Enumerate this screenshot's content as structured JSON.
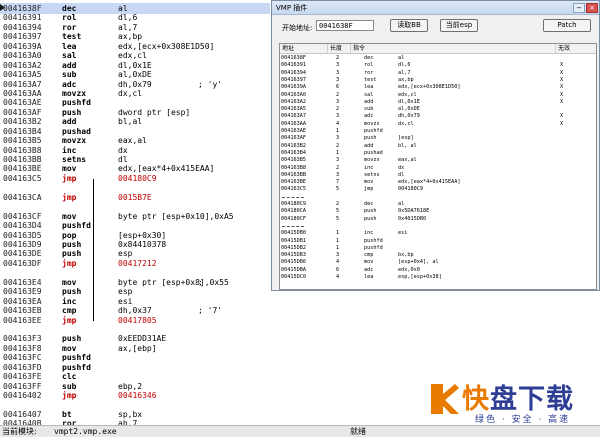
{
  "disasm": {
    "rows": [
      {
        "addr": "0041638F",
        "mn": "dec",
        "op": "al",
        "cm": "",
        "hl": true
      },
      {
        "addr": "00416391",
        "mn": "rol",
        "op": "dl,6",
        "cm": ""
      },
      {
        "addr": "00416394",
        "mn": "ror",
        "op": "al,7",
        "cm": ""
      },
      {
        "addr": "00416397",
        "mn": "test",
        "op": "ax,bp",
        "cm": ""
      },
      {
        "addr": "0041639A",
        "mn": "lea",
        "op": "edx,[ecx+0x308E1D50]",
        "cm": ""
      },
      {
        "addr": "004163A0",
        "mn": "sal",
        "op": "edx,cl",
        "cm": ""
      },
      {
        "addr": "004163A2",
        "mn": "add",
        "op": "dl,0x1E",
        "cm": ""
      },
      {
        "addr": "004163A5",
        "mn": "sub",
        "op": "al,0xDE",
        "cm": ""
      },
      {
        "addr": "004163A7",
        "mn": "adc",
        "op": "dh,0x79",
        "cm": "; 'y'"
      },
      {
        "addr": "004163AA",
        "mn": "movzx",
        "op": "dx,cl",
        "cm": ""
      },
      {
        "addr": "004163AE",
        "mn": "pushfd",
        "op": "",
        "cm": ""
      },
      {
        "addr": "004163AF",
        "mn": "push",
        "op": "dword ptr [esp]",
        "cm": ""
      },
      {
        "addr": "004163B2",
        "mn": "add",
        "op": "bl,al",
        "cm": ""
      },
      {
        "addr": "004163B4",
        "mn": "pushad",
        "op": "",
        "cm": ""
      },
      {
        "addr": "004163B5",
        "mn": "movzx",
        "op": "eax,al",
        "cm": ""
      },
      {
        "addr": "004163B8",
        "mn": "inc",
        "op": "dx",
        "cm": ""
      },
      {
        "addr": "004163BB",
        "mn": "setns",
        "op": "dl",
        "cm": ""
      },
      {
        "addr": "004163BE",
        "mn": "mov",
        "op": "edx,[eax*4+0x415EAA]",
        "cm": ""
      },
      {
        "addr": "004163C5",
        "mn": "jmp",
        "op": "004180C9",
        "cm": "",
        "jmp": true
      },
      {
        "addr": "",
        "mn": "",
        "op": "",
        "cm": ""
      },
      {
        "addr": "004163CA",
        "mn": "jmp",
        "op": "0015B7E",
        "cm": "",
        "jmp": true
      },
      {
        "addr": "",
        "mn": "",
        "op": "",
        "cm": ""
      },
      {
        "addr": "004163CF",
        "mn": "mov",
        "op": "byte ptr [esp+0x10],0xA5",
        "cm": ""
      },
      {
        "addr": "004163D4",
        "mn": "pushfd",
        "op": "",
        "cm": ""
      },
      {
        "addr": "004163D5",
        "mn": "pop",
        "op": "[esp+0x30]",
        "cm": ""
      },
      {
        "addr": "004163D9",
        "mn": "push",
        "op": "0x84410378",
        "cm": ""
      },
      {
        "addr": "004163DE",
        "mn": "push",
        "op": "esp",
        "cm": ""
      },
      {
        "addr": "004163DF",
        "mn": "jmp",
        "op": "00417212",
        "cm": "",
        "jmp": true
      },
      {
        "addr": "",
        "mn": "",
        "op": "",
        "cm": ""
      },
      {
        "addr": "004163E4",
        "mn": "mov",
        "op": "byte ptr [esp+0x8],0x55",
        "cm": ";"
      },
      {
        "addr": "004163E9",
        "mn": "push",
        "op": "esp",
        "cm": ""
      },
      {
        "addr": "004163EA",
        "mn": "inc",
        "op": "esi",
        "cm": ""
      },
      {
        "addr": "004163EB",
        "mn": "cmp",
        "op": "dh,0x37",
        "cm": "; '7'"
      },
      {
        "addr": "004163EE",
        "mn": "jmp",
        "op": "00417805",
        "cm": "",
        "jmp": true
      },
      {
        "addr": "",
        "mn": "",
        "op": "",
        "cm": ""
      },
      {
        "addr": "004163F3",
        "mn": "push",
        "op": "0xEEDD31AE",
        "cm": ""
      },
      {
        "addr": "004163F8",
        "mn": "mov",
        "op": "ax,[ebp]",
        "cm": ""
      },
      {
        "addr": "004163FC",
        "mn": "pushfd",
        "op": "",
        "cm": ""
      },
      {
        "addr": "004163FD",
        "mn": "pushfd",
        "op": "",
        "cm": ""
      },
      {
        "addr": "004163FE",
        "mn": "clc",
        "op": "",
        "cm": ""
      },
      {
        "addr": "004163FF",
        "mn": "sub",
        "op": "ebp,2",
        "cm": ""
      },
      {
        "addr": "00416402",
        "mn": "jmp",
        "op": "00416346",
        "cm": "",
        "jmp": true
      },
      {
        "addr": "",
        "mn": "",
        "op": "",
        "cm": ""
      },
      {
        "addr": "00416407",
        "mn": "bt",
        "op": "sp,bx",
        "cm": ""
      },
      {
        "addr": "0041640B",
        "mn": "ror",
        "op": "ah,7",
        "cm": ""
      }
    ]
  },
  "status": {
    "module": "当前模块:",
    "file": "vmpt2.vmp.exe",
    "state": "就绪"
  },
  "vmp": {
    "title": "VMP 插件",
    "start_label": "开始地址:",
    "start_value": "0041638F",
    "read_bb": "读取BB",
    "current_esp": "当前esp",
    "patch": "Patch",
    "columns": [
      "地址",
      "长度",
      "指令",
      "无效"
    ],
    "rows": [
      {
        "a": "0041638F",
        "l": "2",
        "i1": "dec",
        "i2": "al",
        "x": ""
      },
      {
        "a": "00416391",
        "l": "3",
        "i1": "rol",
        "i2": "dl,6",
        "x": "X"
      },
      {
        "a": "00416394",
        "l": "3",
        "i1": "ror",
        "i2": "al,7",
        "x": "X"
      },
      {
        "a": "00416397",
        "l": "3",
        "i1": "test",
        "i2": "ax,bp",
        "x": "X"
      },
      {
        "a": "0041639A",
        "l": "6",
        "i1": "lea",
        "i2": "edx,[ecx+0x308E1D50]",
        "x": "X"
      },
      {
        "a": "004163A0",
        "l": "2",
        "i1": "sal",
        "i2": "edx,cl",
        "x": "X"
      },
      {
        "a": "004163A2",
        "l": "3",
        "i1": "add",
        "i2": "dl,0x1E",
        "x": "X"
      },
      {
        "a": "004163A5",
        "l": "2",
        "i1": "sub",
        "i2": "al,0xDE",
        "x": ""
      },
      {
        "a": "004163A7",
        "l": "3",
        "i1": "adc",
        "i2": "dh,0x79",
        "x": "X"
      },
      {
        "a": "004163AA",
        "l": "4",
        "i1": "movzx",
        "i2": "dx,cl",
        "x": "X"
      },
      {
        "a": "004163AE",
        "l": "1",
        "i1": "pushfd",
        "i2": "",
        "x": ""
      },
      {
        "a": "004163AF",
        "l": "3",
        "i1": "push",
        "i2": "[esp]",
        "x": ""
      },
      {
        "a": "004163B2",
        "l": "2",
        "i1": "add",
        "i2": "bl, al",
        "x": ""
      },
      {
        "a": "004163B4",
        "l": "1",
        "i1": "pushad",
        "i2": "",
        "x": ""
      },
      {
        "a": "004163B5",
        "l": "3",
        "i1": "movzx",
        "i2": "eax,al",
        "x": ""
      },
      {
        "a": "004163B8",
        "l": "2",
        "i1": "inc",
        "i2": "dx",
        "x": ""
      },
      {
        "a": "004163BB",
        "l": "3",
        "i1": "setns",
        "i2": "dl",
        "x": ""
      },
      {
        "a": "004163BE",
        "l": "7",
        "i1": "mov",
        "i2": "edx,[eax*4+0x415EAA]",
        "x": ""
      },
      {
        "a": "004163C5",
        "l": "5",
        "i1": "jmp",
        "i2": "004180C9",
        "x": ""
      },
      {
        "sep": true
      },
      {
        "a": "004180C9",
        "l": "2",
        "i1": "dec",
        "i2": "al",
        "x": ""
      },
      {
        "a": "004180CA",
        "l": "5",
        "i1": "push",
        "i2": "0x5DA7618E",
        "x": ""
      },
      {
        "a": "004180CF",
        "l": "5",
        "i1": "push",
        "i2": "0x4015DB0",
        "x": ""
      },
      {
        "sep": true
      },
      {
        "a": "00415DB0",
        "l": "1",
        "i1": "inc",
        "i2": "esi",
        "x": ""
      },
      {
        "a": "00415DB1",
        "l": "1",
        "i1": "pushfd",
        "i2": "",
        "x": ""
      },
      {
        "a": "00415DB2",
        "l": "1",
        "i1": "pushfd",
        "i2": "",
        "x": ""
      },
      {
        "a": "00415DB3",
        "l": "3",
        "i1": "cmp",
        "i2": "bx,bp",
        "x": ""
      },
      {
        "a": "00415DB6",
        "l": "4",
        "i1": "mov",
        "i2": "[esp+0x4], al",
        "x": ""
      },
      {
        "a": "00415DBA",
        "l": "6",
        "i1": "adc",
        "i2": "edx,0x0",
        "x": ""
      },
      {
        "a": "00415DC0",
        "l": "4",
        "i1": "lea",
        "i2": "esp,[esp+0x38]",
        "x": ""
      }
    ]
  },
  "logo": {
    "main_a": "快",
    "main_b": "盘下载",
    "sub": "绿色 · 安全 · 高速",
    "brand_color": "#2e3e94",
    "accent_color": "#e87a00"
  }
}
